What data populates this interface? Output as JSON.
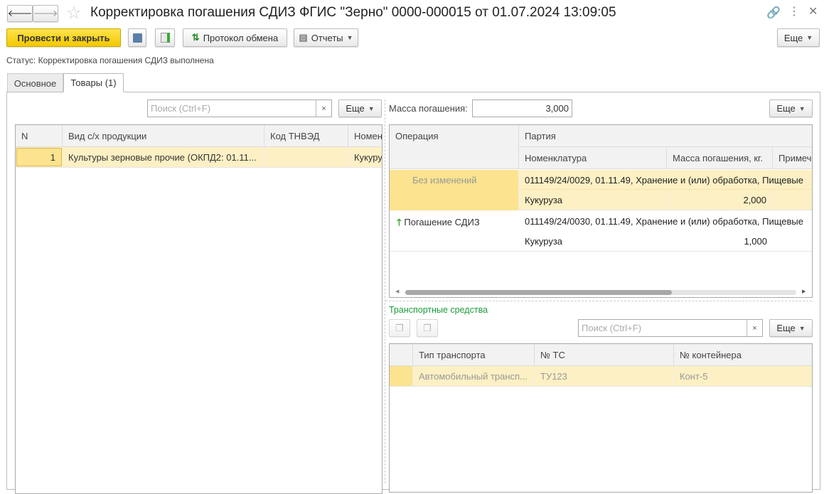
{
  "header": {
    "title": "Корректировка погашения СДИЗ ФГИС \"Зерно\" 0000-000015 от 01.07.2024 13:09:05"
  },
  "toolbar": {
    "post_close": "Провести и закрыть",
    "exchange_log": "Протокол обмена",
    "reports": "Отчеты",
    "more": "Еще"
  },
  "status": "Статус: Корректировка погашения СДИЗ выполнена",
  "tabs": [
    {
      "label": "Основное"
    },
    {
      "label": "Товары (1)",
      "active": true
    }
  ],
  "left": {
    "search_placeholder": "Поиск (Ctrl+F)",
    "more": "Еще",
    "columns": [
      "N",
      "Вид с/х продукции",
      "Код ТНВЭД",
      "Номен"
    ],
    "rows": [
      {
        "n": "1",
        "type": "Культуры зерновые прочие (ОКПД2: 01.11...",
        "code": "",
        "nom": "Кукуруз"
      }
    ]
  },
  "right": {
    "mass_label": "Масса погашения:",
    "mass_value": "3,000",
    "more": "Еще",
    "columns": {
      "operation": "Операция",
      "batch": "Партия",
      "nomenclature": "Номенклатура",
      "mass": "Масса погашения, кг.",
      "note": "Примеча"
    },
    "rows": [
      {
        "operation": "Без изменений",
        "batch": "011149/24/0029, 01.11.49, Хранение и (или) обработка, Пищевые",
        "nomenclature": "Кукуруза",
        "mass": "2,000",
        "selected": true
      },
      {
        "operation": "Погашение СДИЗ",
        "icon": "green-arrow-up-icon",
        "batch": "011149/24/0030, 01.11.49, Хранение и (или) обработка, Пищевые",
        "nomenclature": "Кукуруза",
        "mass": "1,000"
      }
    ]
  },
  "transport": {
    "title": "Транспортные средства",
    "search_placeholder": "Поиск (Ctrl+F)",
    "more": "Еще",
    "columns": [
      "Тип транспорта",
      "№ ТС",
      "№ контейнера"
    ],
    "rows": [
      {
        "type": "Автомобильный трансп...",
        "ts": "ТУ123",
        "container": "Конт-5"
      }
    ]
  },
  "colors": {
    "accent_yellow": "#f2c800",
    "selected_row": "#fdf0c4",
    "selected_cell": "#fbe38f",
    "section_title": "#1a9c3a"
  }
}
